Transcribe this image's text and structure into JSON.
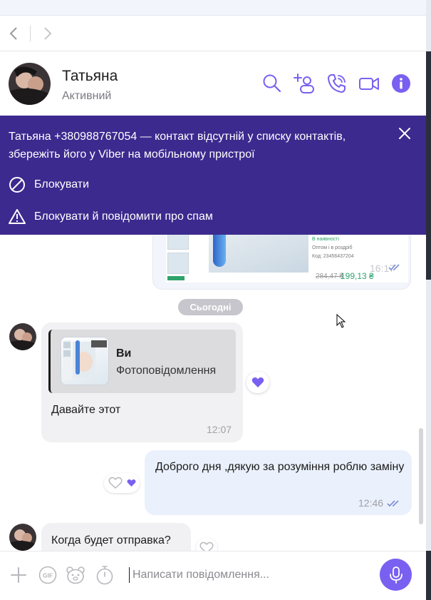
{
  "contact": {
    "name": "Татьяна",
    "status": "Активний"
  },
  "banner": {
    "text": "Татьяна +380988767054 — контакт відсутній у списку контактів, збережіть його у Viber на мобільному пристрої",
    "block_label": "Блокувати",
    "block_spam_label": "Блокувати й повідомити про спам"
  },
  "image_message": {
    "stock_label": "В наявності",
    "wholesale": "Оптом і в роздріб",
    "code": "Код: 23456437204",
    "old_price": "284,47 ₴",
    "new_price": "199,13 ₴",
    "time": "16:17"
  },
  "date_separator": "Сьогодні",
  "messages": [
    {
      "direction": "incoming",
      "reply_author": "Ви",
      "reply_type": "Фотоповідомлення",
      "text": "Давайте этот",
      "time": "12:07"
    },
    {
      "direction": "outgoing",
      "text": "Доброго дня ,дякую за розуміння роблю заміну",
      "time": "12:46"
    },
    {
      "direction": "incoming",
      "text": "Когда будет отправка?"
    }
  ],
  "composer": {
    "placeholder": "Написати повідомлення..."
  },
  "colors": {
    "accent": "#7a60f0",
    "banner_bg": "#3c2a8e",
    "incoming_bubble": "#f1f1f3",
    "outgoing_bubble": "#eaf1fc"
  }
}
